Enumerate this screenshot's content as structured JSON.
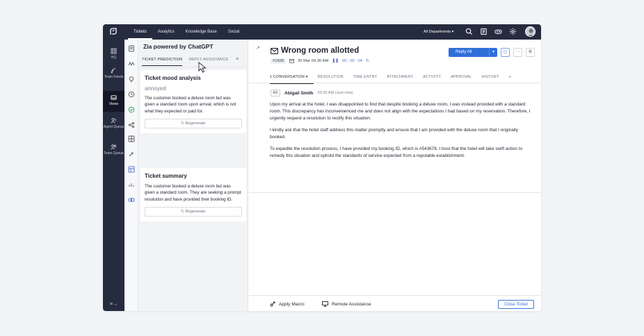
{
  "topnav": {
    "items": [
      "Tickets",
      "Analytics",
      "Knowledge Base",
      "Social"
    ],
    "department": "All Departments ▾"
  },
  "sidebar": {
    "items": [
      {
        "label": "HQ",
        "icon": "grid-icon"
      },
      {
        "label": "Team Feeds",
        "icon": "feed-icon"
      },
      {
        "label": "Views",
        "icon": "inbox-icon"
      },
      {
        "label": "Agent Queue",
        "icon": "agent-icon"
      },
      {
        "label": "Team Queue",
        "icon": "team-icon"
      }
    ],
    "collapse": "≡→"
  },
  "zia": {
    "title": "Zia powered by ChatGPT",
    "tabs": [
      "TICKET PREDICTION",
      "REPLY ASSISTANCE"
    ],
    "mood_card": {
      "heading": "Ticket mood analysis",
      "mood": "annoyed",
      "text": "The customer booked a deluxe room but was given a standard room upon arrival, which is not what they expected or paid for.",
      "regenerate": "↻ Regenerate"
    },
    "summary_card": {
      "heading": "Ticket summary",
      "text": "The customer booked a deluxe room but was given a standard room. They are seeking a  prompt resolution and have provided their booking ID.",
      "regenerate": "↻ Regenerate"
    }
  },
  "ticket": {
    "title": "Wrong room allotted",
    "id": "#1828",
    "date": "30 Mar 09:30 AM",
    "timer": "00 : 00 : 04",
    "reply_button": "Reply All",
    "more": "···",
    "tabs": [
      "1 CONVERSATION ▾",
      "RESOLUTION",
      "TIME ENTRY",
      "ATTACHMENT",
      "ACTIVITY",
      "APPROVAL",
      "HISTORY"
    ],
    "sender_initials": "AS",
    "sender": "Abigail Smith",
    "sent_time": "09:30 AM (Just now)",
    "body": [
      "Upon my arrival at the hotel, I was disappointed to find that despite booking a deluxe room, I was instead provided with a standard room. This discrepancy has inconvenienced me and does not align with the expectations I had based on my reservation. Therefore, I urgently request a resolution to rectify this situation.",
      "I kindly ask that the hotel staff address this matter promptly and ensure that I am provided with the deluxe room that I originally booked.",
      "To expedite the resolution process, I have provided my booking ID, which is #543678. I trust that the hotel will take swift action to remedy this situation and uphold the standards of service expected from a reputable establishment."
    ]
  },
  "footer": {
    "apply_macro": "Apply Macro",
    "remote_assistance": "Remote Assistance",
    "close_ticket": "Close Ticket"
  },
  "colors": {
    "nav_bg": "#262c3f",
    "accent": "#2f6fd8"
  }
}
